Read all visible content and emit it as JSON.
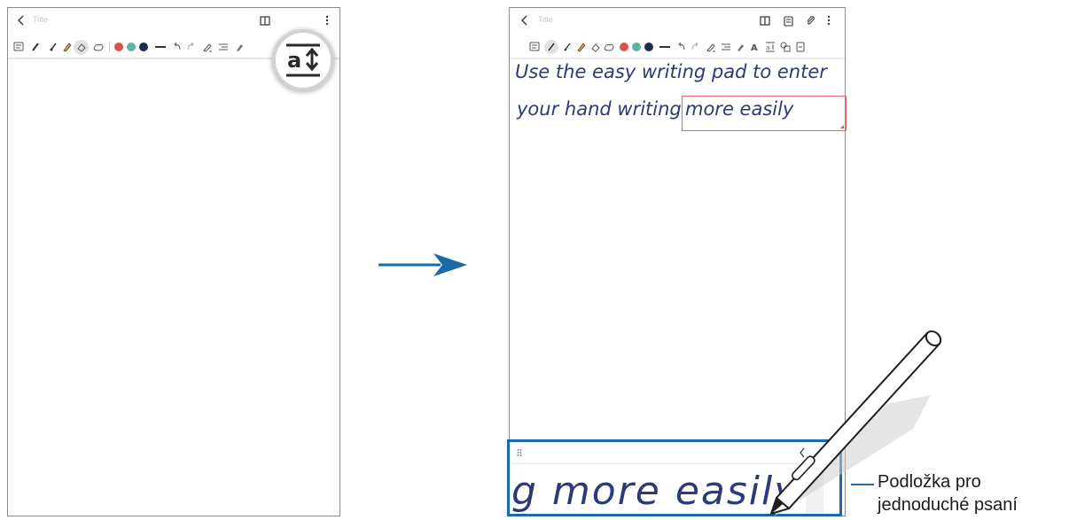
{
  "left_screen": {
    "note_title": "Title",
    "magnifier_icon": "text-convert-icon"
  },
  "right_screen": {
    "note_title": "Title",
    "handwriting_line1": "Use the easy writing pad to enter",
    "handwriting_line2_part1": "your hand writing",
    "handwriting_line2_part2": "more easily"
  },
  "writing_pad": {
    "text": "g more easily"
  },
  "callout": {
    "line1": "Podložka pro",
    "line2": "jednoduché psaní"
  },
  "colors": {
    "pen_ink": "#2c3a7a",
    "accent_blue": "#1a6aa8",
    "selection_red": "#e06a6a",
    "color_red": "#d9534f",
    "color_teal": "#5fb3a8",
    "color_navy": "#1f2d4d"
  }
}
